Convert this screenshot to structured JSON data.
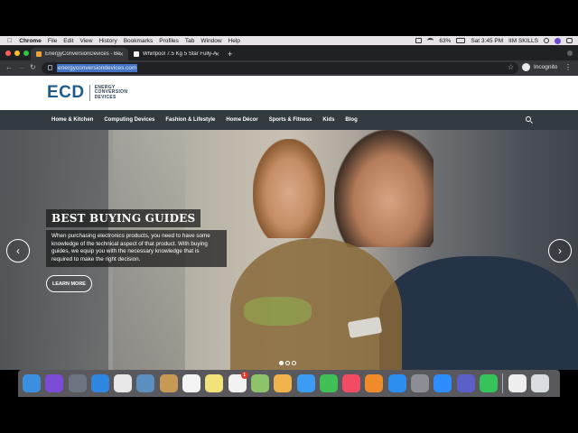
{
  "menubar": {
    "app_name": "Chrome",
    "items": [
      "File",
      "Edit",
      "View",
      "History",
      "Bookmarks",
      "Profiles",
      "Tab",
      "Window",
      "Help"
    ],
    "battery": "63%",
    "clock": "Sat 3:45 PM",
    "user": "IIM SKILLS"
  },
  "browser": {
    "tabs": [
      {
        "title": "EnergyConversionDevices - Be",
        "active": true,
        "favicon_color": "#e8a33d"
      },
      {
        "title": "Whirlpool 7.5 Kg 5 Star Fully-A",
        "active": false,
        "favicon_color": "#f2f2f2"
      }
    ],
    "url": "energyconversiondevices.com",
    "profile_label": "Incognito"
  },
  "site": {
    "logo_mark": "ECD",
    "logo_words": [
      "ENERGY",
      "CONVERSION",
      "DEVICES"
    ],
    "nav": [
      "Home & Kitchen",
      "Computing Devices",
      "Fashion & Lifestyle",
      "Home Décor",
      "Sports & Fitness",
      "Kids",
      "Blog"
    ],
    "hero": {
      "title": "BEST BUYING GUIDES",
      "text": "When purchasing electronics products, you need to have some knowledge of the technical aspect of that product. With buying guides, we equip you with the necessary knowledge that is required to make the right decision.",
      "button": "LEARN MORE",
      "prev_icon": "‹",
      "next_icon": "›",
      "slide_index": 1,
      "slide_count": 3
    }
  },
  "dock": {
    "apps": [
      {
        "name": "finder-icon",
        "color": "#3b8fe0"
      },
      {
        "name": "siri-icon",
        "color": "#7b4bd6"
      },
      {
        "name": "launchpad-icon",
        "color": "#6b7480"
      },
      {
        "name": "safari-icon",
        "color": "#2f86e0"
      },
      {
        "name": "chrome-icon",
        "color": "#e8e8e8"
      },
      {
        "name": "preview-icon",
        "color": "#5a8fbf"
      },
      {
        "name": "notes-stack-icon",
        "color": "#c69a55"
      },
      {
        "name": "calendar-icon",
        "color": "#f4f4f4"
      },
      {
        "name": "stickies-icon",
        "color": "#f1e27a"
      },
      {
        "name": "reminders-icon",
        "color": "#f2f2f2",
        "badge": "1"
      },
      {
        "name": "maps-icon",
        "color": "#8cc36b"
      },
      {
        "name": "photos-icon",
        "color": "#f0b24a"
      },
      {
        "name": "messages-icon",
        "color": "#3c9cf3"
      },
      {
        "name": "facetime-icon",
        "color": "#3fbf55"
      },
      {
        "name": "music-icon",
        "color": "#f24b63"
      },
      {
        "name": "books-icon",
        "color": "#f08b2b"
      },
      {
        "name": "app-store-icon",
        "color": "#2c8ff0"
      },
      {
        "name": "system-preferences-icon",
        "color": "#8b8f95"
      },
      {
        "name": "zoom-icon",
        "color": "#2d8cff"
      },
      {
        "name": "teams-icon",
        "color": "#5b5fc7"
      },
      {
        "name": "whatsapp-icon",
        "color": "#35c45a"
      },
      {
        "name": "document-icon",
        "color": "#eeeeee"
      },
      {
        "name": "trash-icon",
        "color": "#d9dde2"
      }
    ]
  }
}
